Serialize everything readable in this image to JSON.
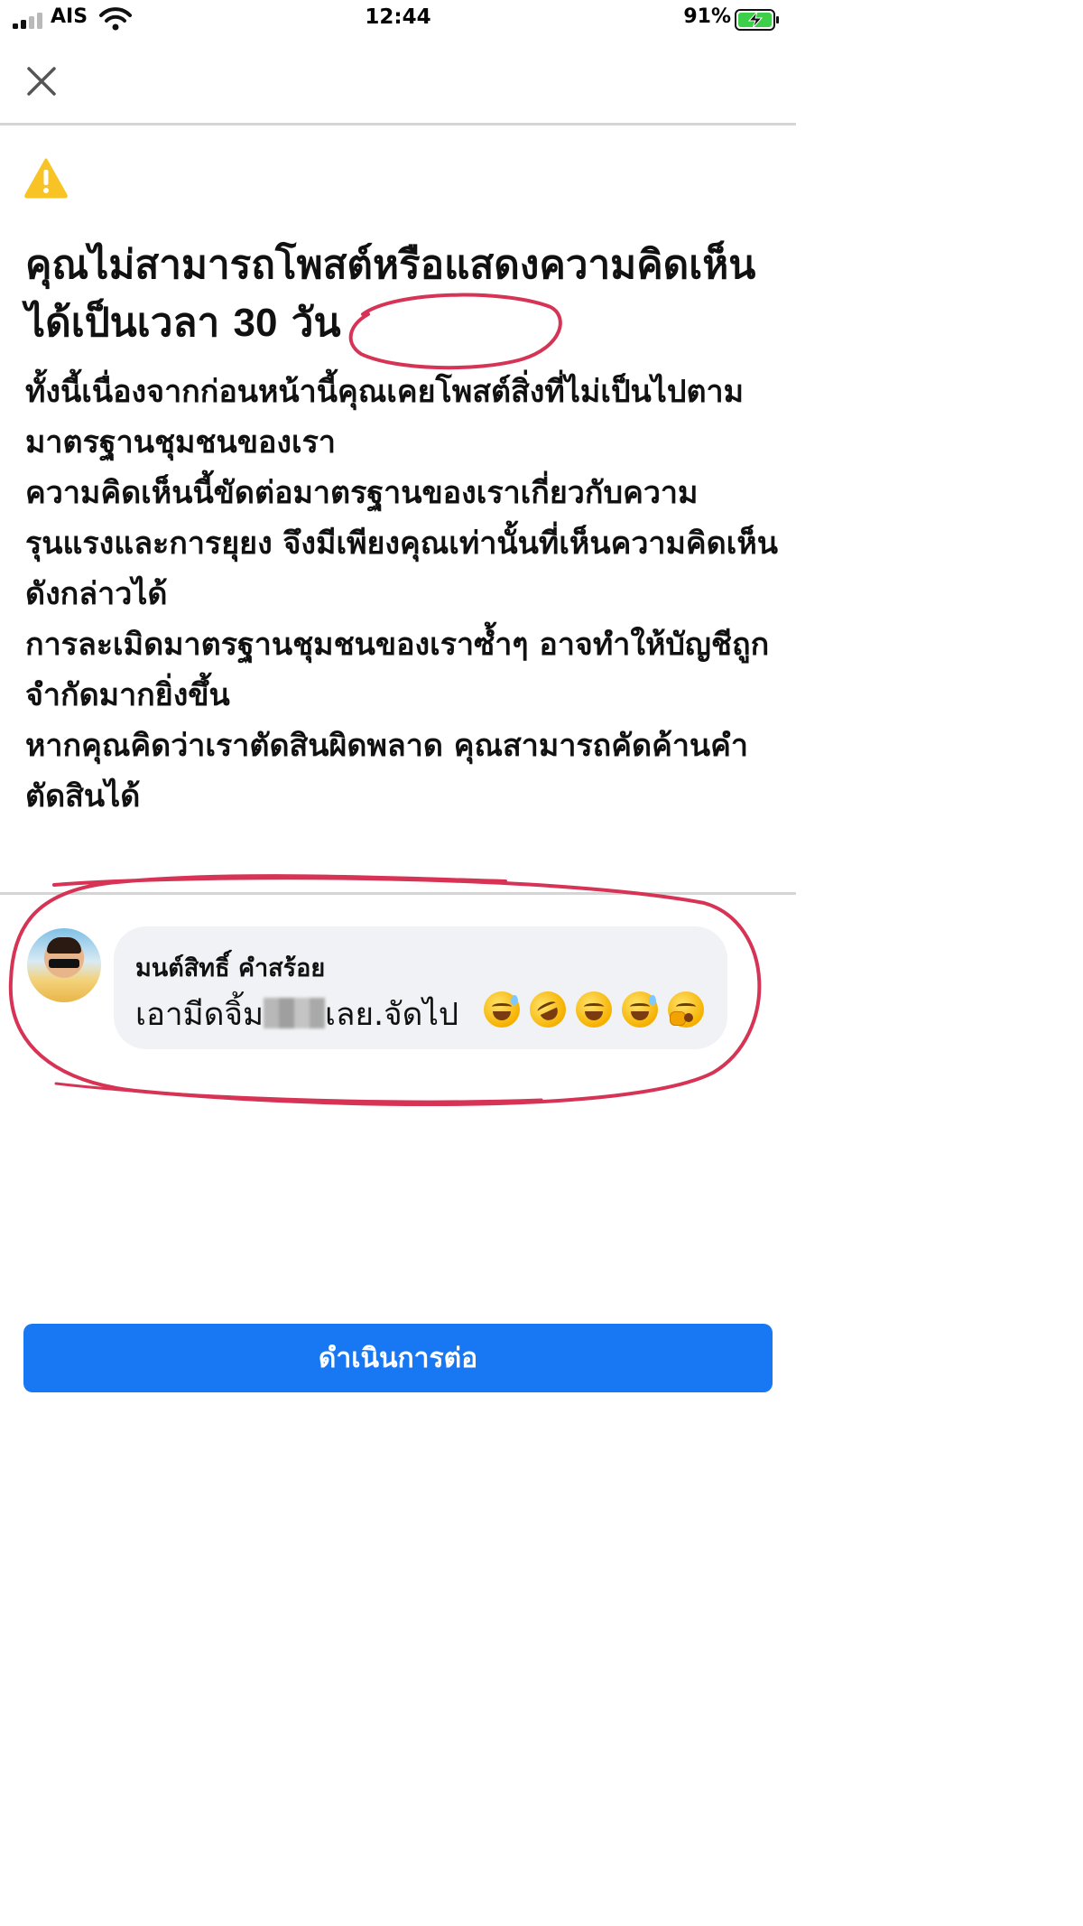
{
  "status_bar": {
    "carrier": "AIS",
    "time": "12:44",
    "battery": "91%"
  },
  "header": {
    "close_icon": "close-icon"
  },
  "notice": {
    "icon": "warning-icon",
    "headline_before": "คุณไม่สามารถโพสต์หรือแสดงความคิดเห็นได้เป็นเวลา ",
    "headline_days": "30",
    "headline_unit": " วัน",
    "paragraphs": [
      "ทั้งนี้เนื่องจากก่อนหน้านี้คุณเคยโพสต์สิ่งที่ไม่เป็นไปตามมาตรฐานชุมชนของเรา",
      "ความคิดเห็นนี้ขัดต่อมาตรฐานของเราเกี่ยวกับความรุนแรงและการยุยง จึงมีเพียงคุณเท่านั้นที่เห็นความคิดเห็นดังกล่าวได้",
      "การละเมิดมาตรฐานชุมชนของเราซ้ำๆ อาจทำให้บัญชีถูกจำกัดมากยิ่งขึ้น",
      "หากคุณคิดว่าเราตัดสินผิดพลาด คุณสามารถคัดค้านคำตัดสินได้"
    ]
  },
  "comment": {
    "author": "มนต์สิทธิ์ คำสร้อย",
    "text_before": "เอามีดจิ้ม",
    "text_after": "เลย.จัดไป",
    "emojis": [
      "grinning-sweat",
      "rolling-laughing",
      "grinning",
      "grinning-sweat",
      "yawning"
    ]
  },
  "actions": {
    "continue_label": "ดำเนินการต่อ"
  },
  "colors": {
    "primary_button": "#1877f2",
    "annotation_ring": "#d63355",
    "warning": "#f7c325",
    "comment_bubble": "#f0f2f5"
  }
}
